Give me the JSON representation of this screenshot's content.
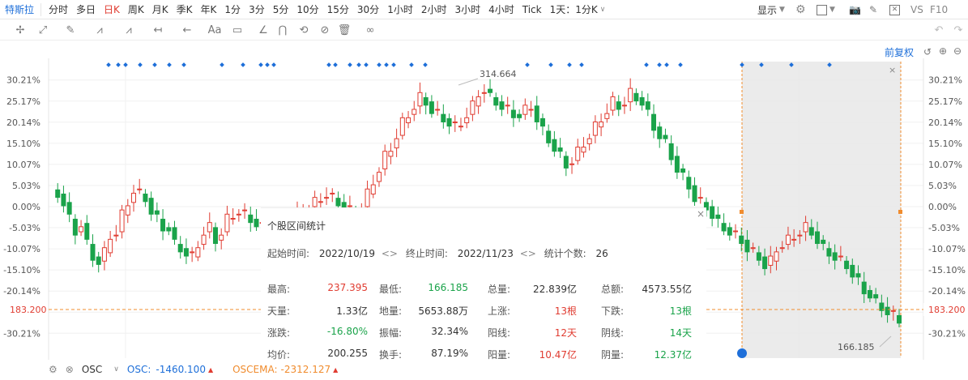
{
  "toolbar": {
    "stock_name": "特斯拉",
    "timeframes": [
      "分时",
      "多日",
      "日K",
      "周K",
      "月K",
      "季K",
      "年K",
      "1分",
      "3分",
      "5分",
      "10分",
      "15分",
      "30分",
      "1小时",
      "2小时",
      "3小时",
      "4小时",
      "Tick",
      "1天：1分K"
    ],
    "active_timeframe": "日K",
    "display_label": "显示",
    "vs_label": "VS",
    "f10_label": "F10"
  },
  "drawing_tools": [
    "crosshair-icon",
    "trend-line-icon",
    "pen-icon",
    "fib-icon",
    "measure-icon",
    "arrow-icon",
    "text-icon",
    "note-icon",
    "ruler-icon",
    "magnet-icon",
    "lock-icon",
    "hide-icon",
    "delete-icon",
    "link-icon",
    "settings-icon"
  ],
  "adjust_label": "前复权",
  "y_axis": {
    "labels": [
      "30.21%",
      "25.17%",
      "20.14%",
      "15.10%",
      "10.07%",
      "5.03%",
      "0.00%",
      "-5.03%",
      "-10.07%",
      "-15.10%",
      "-20.14%",
      "-25.17%",
      "-30.21%"
    ],
    "current_price": "183.200"
  },
  "annotations": {
    "high": "314.664",
    "low": "166.185"
  },
  "chart_data": {
    "type": "candlestick",
    "y_unit": "percent change",
    "ylim": [
      -33,
      33
    ],
    "reference_line": 183.2,
    "marked_high": 314.664,
    "marked_low": 166.185
  },
  "stats_panel": {
    "title": "个股区间统计",
    "start_label": "起始时间:",
    "start_value": "2022/10/19",
    "end_label": "终止时间:",
    "end_value": "2022/11/23",
    "count_label": "统计个数:",
    "count_value": "26",
    "cells": [
      {
        "label": "最高:",
        "value": "237.395",
        "color": "red"
      },
      {
        "label": "最低:",
        "value": "166.185",
        "color": "green"
      },
      {
        "label": "总量:",
        "value": "22.839亿",
        "color": "dark"
      },
      {
        "label": "总额:",
        "value": "4573.55亿",
        "color": "dark"
      },
      {
        "label": "天量:",
        "value": "1.33亿",
        "color": "dark"
      },
      {
        "label": "地量:",
        "value": "5653.88万",
        "color": "dark"
      },
      {
        "label": "上涨:",
        "value": "13根",
        "color": "red"
      },
      {
        "label": "下跌:",
        "value": "13根",
        "color": "green"
      },
      {
        "label": "涨跌:",
        "value": "-16.80%",
        "color": "green"
      },
      {
        "label": "振幅:",
        "value": "32.34%",
        "color": "dark"
      },
      {
        "label": "阳线:",
        "value": "12天",
        "color": "red"
      },
      {
        "label": "阴线:",
        "value": "14天",
        "color": "green"
      },
      {
        "label": "均价:",
        "value": "200.255",
        "color": "dark"
      },
      {
        "label": "换手:",
        "value": "87.19%",
        "color": "dark"
      },
      {
        "label": "阳量:",
        "value": "10.47亿",
        "color": "red"
      },
      {
        "label": "阴量:",
        "value": "12.37亿",
        "color": "green"
      }
    ]
  },
  "footer": {
    "indicator": "OSC",
    "osc_label": "OSC:",
    "osc_value": "-1460.100",
    "oscema_label": "OSCEMA:",
    "oscema_value": "-2312.127"
  },
  "colors": {
    "up": "#e03c31",
    "down": "#1aa34a",
    "accent": "#1e6fd9",
    "ref": "#f08c2e"
  }
}
